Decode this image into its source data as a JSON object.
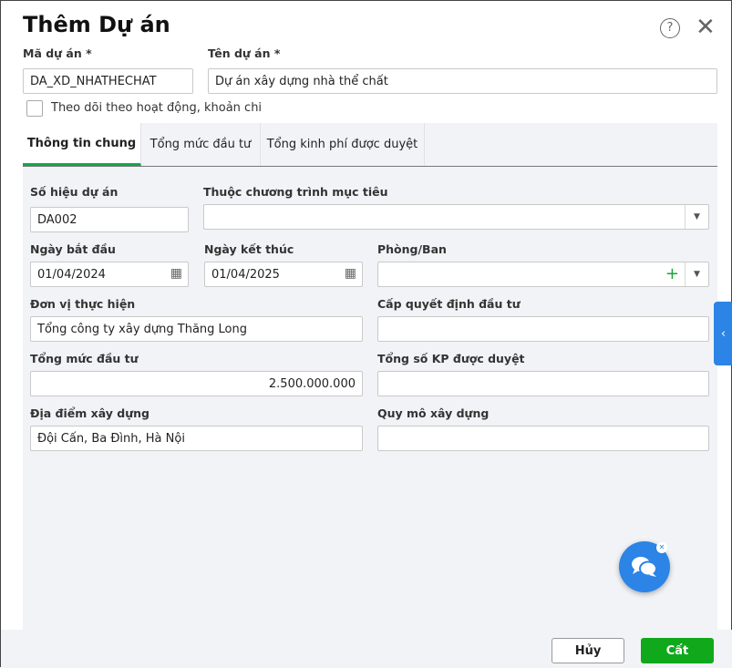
{
  "dialog": {
    "title": "Thêm Dự án"
  },
  "header": {
    "code_label": "Mã dự án *",
    "code_value": "DA_XD_NHATHECHAT",
    "name_label": "Tên dự án *",
    "name_value": "Dự án xây dựng nhà thể chất",
    "track_label": "Theo dõi theo hoạt động, khoản chi",
    "track_checked": false
  },
  "tabs": [
    {
      "label": "Thông tin chung",
      "active": true
    },
    {
      "label": "Tổng mức đầu tư"
    },
    {
      "label": "Tổng kinh phí được duyệt"
    }
  ],
  "form": {
    "so_hieu": {
      "label": "Số hiệu dự án",
      "value": "DA002"
    },
    "chuong_trinh": {
      "label": "Thuộc chương trình mục tiêu",
      "value": ""
    },
    "ngay_bd": {
      "label": "Ngày bắt đầu",
      "value": "01/04/2024"
    },
    "ngay_kt": {
      "label": "Ngày kết thúc",
      "value": "01/04/2025"
    },
    "phong_ban": {
      "label": "Phòng/Ban",
      "value": ""
    },
    "don_vi": {
      "label": "Đơn vị thực hiện",
      "value": "Tổng công ty xây dựng Thăng Long"
    },
    "cap_qd": {
      "label": "Cấp quyết định đầu tư",
      "value": ""
    },
    "tong_muc": {
      "label": "Tổng mức đầu tư",
      "value": "2.500.000.000"
    },
    "tong_kp": {
      "label": "Tổng số KP được duyệt",
      "value": ""
    },
    "dia_diem": {
      "label": "Địa điểm xây dựng",
      "value": "Đội Cấn, Ba Đình, Hà Nội"
    },
    "quy_mo": {
      "label": "Quy mô xây dựng",
      "value": ""
    }
  },
  "footer": {
    "cancel": "Hủy",
    "save": "Cất"
  },
  "colors": {
    "accent": "#0fa84e",
    "save": "#10a91c",
    "chat": "#2b84e6"
  }
}
